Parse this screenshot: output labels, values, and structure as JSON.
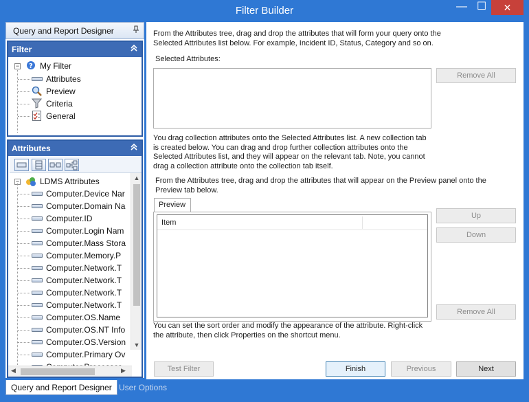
{
  "window": {
    "title": "Filter Builder",
    "minimize": "—",
    "maximize": "☐",
    "close": "✕"
  },
  "left_panel": {
    "header": "Query and Report Designer",
    "pin_icon": "pin-icon",
    "filter": {
      "title": "Filter",
      "collapse_icon": "double-chevron-up-icon",
      "expander": "−",
      "root": "My Filter",
      "items": [
        "Attributes",
        "Preview",
        "Criteria",
        "General"
      ]
    },
    "attributes": {
      "title": "Attributes",
      "collapse_icon": "double-chevron-up-icon",
      "root_expander": "−",
      "root": "LDMS Attributes",
      "items": [
        "Computer.Device Nar",
        "Computer.Domain Na",
        "Computer.ID",
        "Computer.Login Nam",
        "Computer.Mass Stora",
        "Computer.Memory.P",
        "Computer.Network.T",
        "Computer.Network.T",
        "Computer.Network.T",
        "Computer.Network.T",
        "Computer.OS.Name",
        "Computer.OS.NT Info",
        "Computer.OS.Version",
        "Computer.Primary Ov",
        "Computer.Processor"
      ]
    }
  },
  "main": {
    "instructions_1": "From the Attributes tree, drag and drop the attributes that will form your query onto the Selected Attributes list below. For example, Incident ID, Status, Category and so on.",
    "selected_label": "Selected Attributes:",
    "remove_all_1": "Remove All",
    "collection_note": "You drag collection attributes onto the Selected Attributes list. A new collection tab is created below. You can drag and drop further collection attributes onto the Selected Attributes list, and they will appear on the relevant tab. Note, you cannot drag a collection attribute onto the collection tab itself.",
    "preview_note": "From the Attributes tree, drag and drop the attributes that will appear on the Preview panel onto the Preview tab below.",
    "preview_tab": "Preview",
    "grid_column": "Item",
    "up": "Up",
    "down": "Down",
    "remove_all_2": "Remove All",
    "sort_note": "You can set the sort order and modify the appearance of the attribute. Right-click the attribute, then click Properties on the shortcut menu.",
    "test_filter": "Test Filter",
    "finish": "Finish",
    "previous": "Previous",
    "next": "Next"
  },
  "bottom_tabs": [
    "Query and Report Designer",
    "User Options"
  ]
}
